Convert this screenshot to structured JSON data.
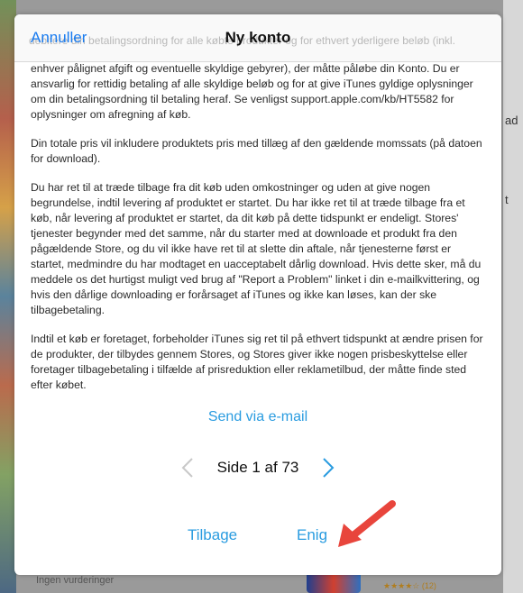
{
  "background": {
    "right_fragment_1": "ad",
    "right_fragment_2": "t",
    "bottom_text": "Ingen vurderinger",
    "rating_text": "★★★★☆ (12)"
  },
  "header": {
    "ghost_text": "debitere din betalingsordning for alle købte produkter og for ethvert yderligere beløb (inkl.",
    "cancel_label": "Annuller",
    "title": "Ny konto"
  },
  "terms": {
    "paragraphs": [
      "enhver pålignet afgift og eventuelle skyldige gebyrer), der måtte påløbe din Konto. Du er ansvarlig for rettidig betaling af alle skyldige beløb og for at give iTunes gyldige oplysninger om din betalingsordning til betaling heraf. Se venligst support.apple.com/kb/HT5582 for oplysninger om afregning af køb.",
      "Din totale pris vil inkludere produktets pris med tillæg af den gældende momssats (på datoen for download).",
      "Du har ret til at træde tilbage fra dit køb uden omkostninger og uden at give nogen begrundelse, indtil levering af produktet er startet. Du har ikke ret til at træde tilbage fra et køb, når levering af produktet er startet, da dit køb på dette tidspunkt er endeligt. Stores' tjenester begynder med det samme, når du starter med at downloade et produkt fra den pågældende Store, og du vil ikke have ret til at slette din aftale, når tjenesterne først er startet, medmindre du har modtaget en uacceptabelt dårlig download. Hvis dette sker, må du meddele os det hurtigst muligt ved brug af \"Report a Problem\" linket i din e-mailkvittering, og hvis den dårlige downloading er forårsaget af iTunes og ikke kan løses, kan der ske tilbagebetaling.",
      "Indtil et køb er foretaget, forbeholder iTunes sig ret til på ethvert tidspunkt at ændre prisen for de produkter, der tilbydes gennem Stores, og Stores giver ikke nogen prisbeskyttelse eller foretager tilbagebetaling i tilfælde af prisreduktion eller reklametilbud, der måtte finde sted efter købet."
    ]
  },
  "actions": {
    "email_label": "Send via e-mail",
    "page_label": "Side 1 af 73",
    "back_label": "Tilbage",
    "agree_label": "Enig"
  },
  "icons": {
    "prev": "chevron-left-icon",
    "next": "chevron-right-icon",
    "annotation": "red-arrow-annotation"
  },
  "colors": {
    "accent_blue": "#2a9ce0",
    "cancel_blue": "#1a7cf0",
    "arrow_red": "#e8453c",
    "chevron_disabled": "#c8c8c8"
  }
}
